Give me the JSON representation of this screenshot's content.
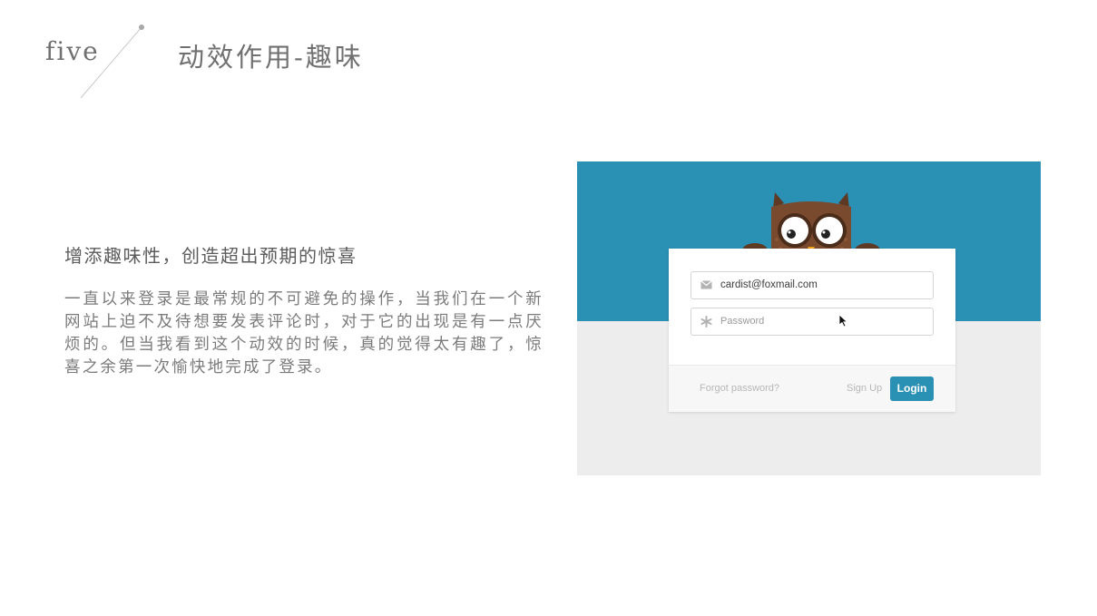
{
  "slide": {
    "number": "five",
    "title": "动效作用-趣味"
  },
  "content": {
    "subheading": "增添趣味性，创造超出预期的惊喜",
    "paragraph": "一直以来登录是最常规的不可避免的操作，当我们在一个新网站上迫不及待想要发表评论时，对于它的出现是有一点厌烦的。但当我看到这个动效的时候，真的觉得太有趣了，惊喜之余第一次愉快地完成了登录。"
  },
  "demo": {
    "colors": {
      "sky": "#2a90b4",
      "ground": "#ededed",
      "owl": "#7a4a2f",
      "accent": "#2a90b4"
    },
    "email_field": {
      "value": "cardist@foxmail.com",
      "icon": "envelope-icon"
    },
    "password_field": {
      "placeholder": "Password",
      "icon": "asterisk-icon"
    },
    "footer": {
      "forgot_label": "Forgot password?",
      "signup_label": "Sign Up",
      "login_label": "Login"
    }
  }
}
